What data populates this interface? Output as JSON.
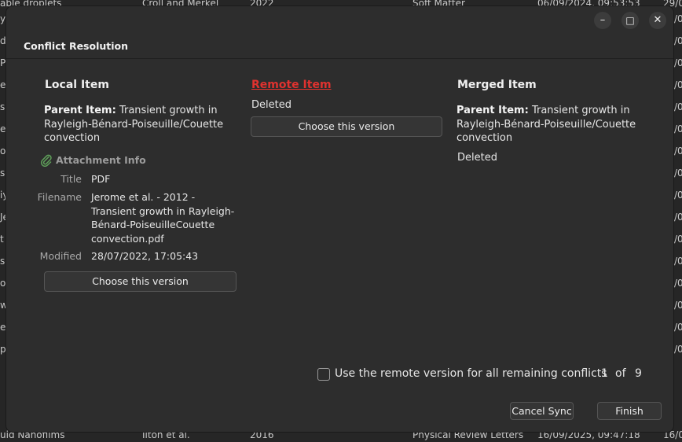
{
  "background": {
    "top_row": [
      "able droplets",
      "Croll and Merkel",
      "2022",
      "Soft Matter",
      "06/09/2024, 09:53:53",
      "29/0"
    ],
    "bottom_row": [
      "uid Nanofilms",
      "Ilton et al.",
      "2016",
      "Physical Review Letters",
      "16/09/2025, 09:47:18",
      "16/0"
    ],
    "left_fragments": [
      "y",
      "d",
      "Po",
      "e",
      "sp",
      "e",
      "ou",
      "se",
      "iy",
      "Je",
      "t",
      "se",
      "o",
      "w",
      "e",
      "p"
    ],
    "right_fragments": [
      "/0",
      "/0",
      "/0",
      "/0",
      "/0",
      "/0",
      "/0",
      "/0",
      "/0",
      "/0",
      "/0",
      "/0",
      "/0",
      "/0",
      "/0",
      "/0"
    ]
  },
  "window_controls": {
    "minimize": "–",
    "maximize": "□",
    "close": "✕"
  },
  "dialog": {
    "title": "Conflict Resolution"
  },
  "local": {
    "heading": "Local Item",
    "parent_label": "Parent Item:",
    "parent_value": "Transient growth in Rayleigh-Bénard-Poiseuille/Couette convection",
    "attachment_heading": "Attachment Info",
    "title_label": "Title",
    "title_value": "PDF",
    "filename_label": "Filename",
    "filename_value": "Jerome et al. - 2012 - Transient growth in Rayleigh-Bénard-PoiseuilleCouette convection.pdf",
    "modified_label": "Modified",
    "modified_value": "28/07/2022, 17:05:43",
    "choose_label": "Choose this version"
  },
  "remote": {
    "heading": "Remote Item",
    "status": "Deleted",
    "choose_label": "Choose this version"
  },
  "merged": {
    "heading": "Merged Item",
    "parent_label": "Parent Item:",
    "parent_value": "Transient growth in Rayleigh-Bénard-Poiseuille/Couette convection",
    "status": "Deleted"
  },
  "footer": {
    "checkbox_label": "Use the remote version for all remaining conflicts",
    "checkbox_checked": false,
    "current": "1",
    "of_label": "of",
    "total": "9",
    "cancel_label": "Cancel Sync",
    "finish_label": "Finish"
  },
  "colors": {
    "remote_heading": "#e0322f",
    "attachment_icon": "#5fa05a"
  },
  "icons": {
    "attachment": "paperclip-icon"
  }
}
